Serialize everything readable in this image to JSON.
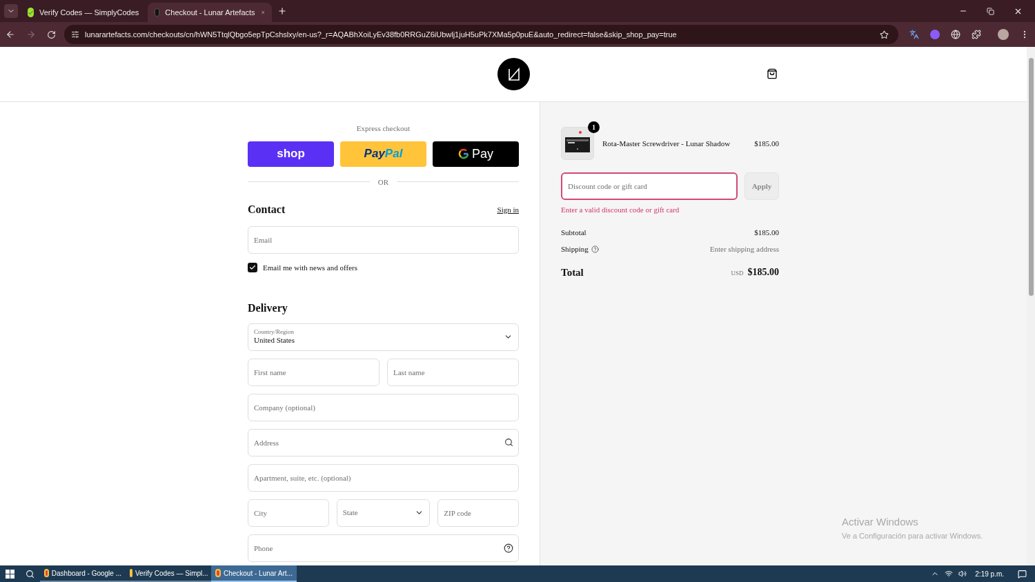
{
  "browser": {
    "tabs": [
      {
        "title": "Verify Codes — SimplyCodes",
        "selected": false
      },
      {
        "title": "Checkout - Lunar Artefacts",
        "selected": true
      }
    ],
    "url": "lunarartefacts.com/checkouts/cn/hWN5TtqlQbgo5epTpCshslxy/en-us?_r=AQABhXoiLyEv38fb0RRGuZ6iUbwlj1juH5uPk7XMa5p0puE&auto_redirect=false&skip_shop_pay=true"
  },
  "express": {
    "title": "Express checkout",
    "shop": "shop",
    "paypal_1": "Pay",
    "paypal_2": "Pal",
    "gpay": "Pay",
    "divider": "OR"
  },
  "contact": {
    "title": "Contact",
    "sign_in": "Sign in",
    "email_placeholder": "Email",
    "newsletter": {
      "label": "Email me with news and offers",
      "checked": true
    }
  },
  "delivery": {
    "title": "Delivery",
    "rows": [
      [
        {
          "kind": "select",
          "label": "Country/Region",
          "value": "United States"
        }
      ],
      [
        {
          "kind": "text",
          "placeholder": "First name"
        },
        {
          "kind": "text",
          "placeholder": "Last name"
        }
      ],
      [
        {
          "kind": "text",
          "placeholder": "Company (optional)"
        }
      ],
      [
        {
          "kind": "search",
          "placeholder": "Address"
        }
      ],
      [
        {
          "kind": "text",
          "placeholder": "Apartment, suite, etc. (optional)"
        }
      ],
      [
        {
          "kind": "text",
          "placeholder": "City"
        },
        {
          "kind": "select",
          "placeholder": "State"
        },
        {
          "kind": "text",
          "placeholder": "ZIP code"
        }
      ],
      [
        {
          "kind": "help",
          "placeholder": "Phone"
        }
      ]
    ]
  },
  "summary": {
    "item": {
      "name": "Rota-Master Screwdriver - Lunar Shadow",
      "price": "$185.00",
      "quantity": "1"
    },
    "discount": {
      "placeholder": "Discount code or gift card",
      "button": "Apply",
      "error": "Enter a valid discount code or gift card"
    },
    "subtotal": {
      "label": "Subtotal",
      "value": "$185.00"
    },
    "shipping": {
      "label": "Shipping",
      "value": "Enter shipping address"
    },
    "total": {
      "label": "Total",
      "currency": "USD",
      "value": "$185.00"
    }
  },
  "windows_notice": {
    "title": "Activar Windows",
    "subtitle": "Ve a Configuración para activar Windows."
  },
  "taskbar": {
    "items": [
      {
        "label": "Dashboard - Google ...",
        "selected": false
      },
      {
        "label": "Verify Codes — Simpl...",
        "selected": false
      },
      {
        "label": "Checkout - Lunar Art...",
        "selected": true
      }
    ],
    "time": "2:19 p.m."
  }
}
